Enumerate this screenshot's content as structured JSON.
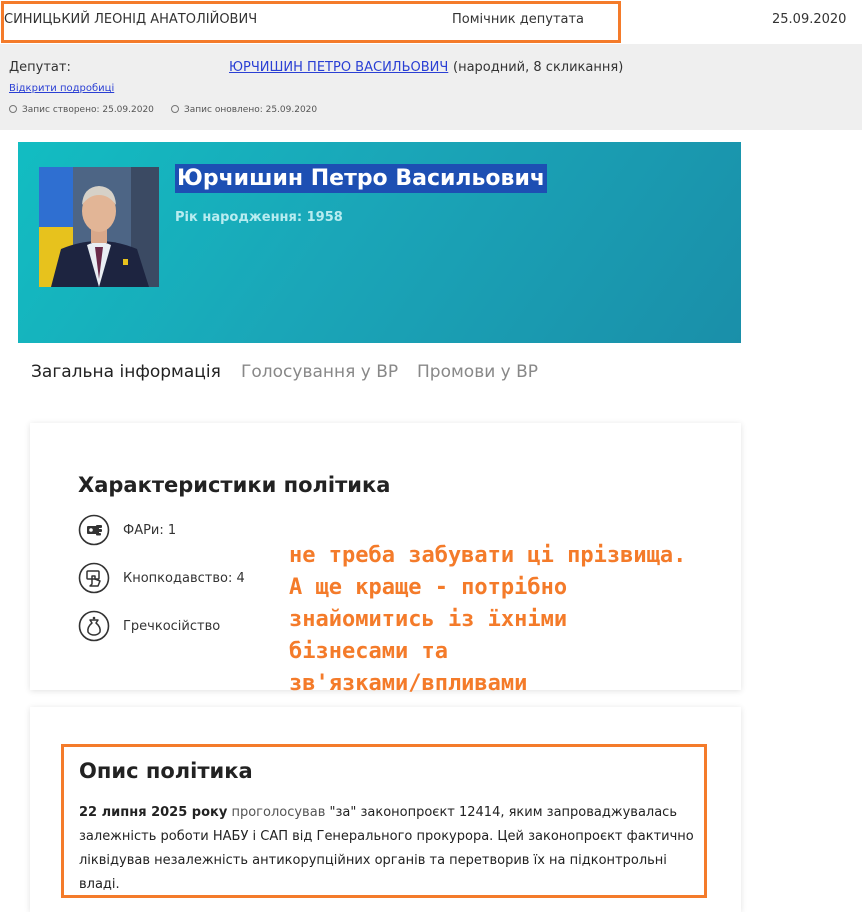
{
  "top": {
    "assistant_name": "СИНИЦЬКИЙ ЛЕОНІД АНАТОЛІЙОВИЧ",
    "assistant_role": "Помічник депутата",
    "date": "25.09.2020"
  },
  "info": {
    "deputy_label": "Депутат:",
    "deputy_name": "ЮРЧИШИН ПЕТРО ВАСИЛЬОВИЧ",
    "deputy_extra": "(народний, 8 скликання)",
    "details_link": "Відкрити подробиці",
    "created": "Запис створено: 25.09.2020",
    "updated": "Запис оновлено: 25.09.2020"
  },
  "profile": {
    "name": "Юрчишин Петро Васильович",
    "birth": "Рік народження: 1958"
  },
  "tabs": [
    {
      "label": "Загальна інформація",
      "active": true
    },
    {
      "label": "Голосування у ВР",
      "active": false
    },
    {
      "label": "Промови у ВР",
      "active": false
    }
  ],
  "characteristics": {
    "title": "Характеристики політика",
    "items": [
      {
        "icon": "money-hand-icon",
        "label": "ФАРи: 1"
      },
      {
        "icon": "button-press-icon",
        "label": "Кнопкодавство: 4"
      },
      {
        "icon": "buckwheat-bag-icon",
        "label": "Гречкосійство"
      }
    ]
  },
  "annotation": "не треба забувати ці прізвища.\nА ще краще - потрібно\nзнайомитись із їхніми\nбізнесами та\nзв'язками/впливами",
  "description": {
    "title": "Опис політика",
    "date": "22 липня 2025 року",
    "verb": "проголосував",
    "text": " \"за\" законопроєкт 12414, яким запроваджувалась залежність роботи НАБУ і САП від Генерального прокурора. Цей законопроєкт фактично ліквідував незалежність антикорупційних органів та перетворив їх на підконтрольні владі."
  },
  "colors": {
    "accent_orange": "#f47b2a",
    "link_blue": "#2a3fd4",
    "hero_teal": "#12bdc2",
    "name_highlight": "#1d4fb3"
  }
}
